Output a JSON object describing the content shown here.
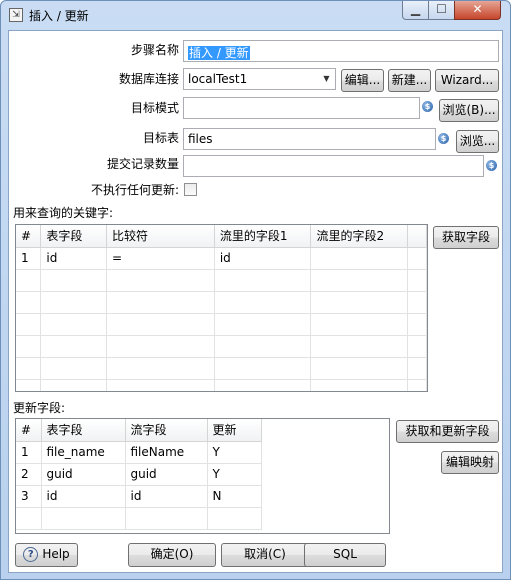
{
  "window": {
    "title": "插入 / 更新",
    "icon_glyph": "⇲",
    "minimize_glyph": "▁",
    "maximize_glyph": "☐",
    "close_glyph": "✕"
  },
  "form": {
    "step_name_label": "步骤名称",
    "step_name_value": "插入 / 更新",
    "db_conn_label": "数据库连接",
    "db_conn_value": "localTest1",
    "edit_button": "编辑...",
    "new_button": "新建...",
    "wizard_button": "Wizard...",
    "target_schema_label": "目标模式",
    "target_schema_value": "",
    "browse_schema_button": "浏览(B)...",
    "target_table_label": "目标表",
    "target_table_value": "files",
    "browse_table_button": "浏览...",
    "commit_size_label": "提交记录数量",
    "commit_size_value": "",
    "no_update_label": "不执行任何更新:",
    "no_update_checked": false
  },
  "key_lookup": {
    "section_label": "用来查询的关键字:",
    "get_fields_button": "获取字段",
    "columns": [
      "#",
      "表字段",
      "比较符",
      "流里的字段1",
      "流里的字段2"
    ],
    "rows": [
      [
        "1",
        "id",
        "=",
        "id",
        ""
      ]
    ]
  },
  "update_fields": {
    "section_label": "更新字段:",
    "get_update_fields_button": "获取和更新字段",
    "edit_mapping_button": "编辑映射",
    "columns": [
      "#",
      "表字段",
      "流字段",
      "更新"
    ],
    "rows": [
      [
        "1",
        "file_name",
        "fileName",
        "Y"
      ],
      [
        "2",
        "guid",
        "guid",
        "Y"
      ],
      [
        "3",
        "id",
        "id",
        "N"
      ]
    ]
  },
  "footer": {
    "help_button": "Help",
    "ok_button": "确定(O)",
    "cancel_button": "取消(C)",
    "sql_button": "SQL"
  },
  "icons": {
    "variable_icon": "variable-dollar-icon",
    "help_icon": "question-circle-icon"
  },
  "colors": {
    "selection": "#3399ff",
    "title_gradient_top": "#c9dcf3",
    "close_button": "#c6452c"
  }
}
